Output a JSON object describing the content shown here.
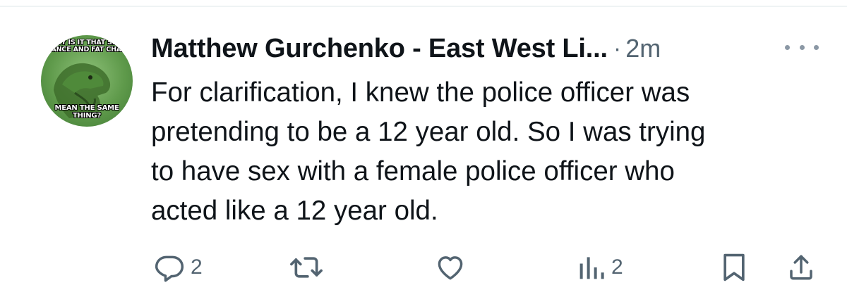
{
  "avatar": {
    "meme_top": [
      "WHY IS IT THAT SLIM",
      "CHANCE AND FAT CHANCE"
    ],
    "meme_bottom": [
      "MEAN THE SAME",
      "THING?"
    ]
  },
  "tweet": {
    "author": "Matthew Gurchenko - East West Li...",
    "separator": "·",
    "time": "2m",
    "text": "For clarification, I knew the police officer was\npretending to be a 12 year old. So I was trying\nto have sex with a female police officer who\nacted like a 12 year old."
  },
  "actions": {
    "reply_count": "2",
    "views_count": "2"
  },
  "icons": {
    "reply": "reply-icon",
    "retweet": "retweet-icon",
    "like": "heart-icon",
    "views": "views-icon",
    "bookmark": "bookmark-icon",
    "share": "share-icon",
    "more": "more-icon"
  },
  "colors": {
    "text": "#0f1419",
    "secondary": "#536471",
    "divider": "#eff3f4"
  }
}
